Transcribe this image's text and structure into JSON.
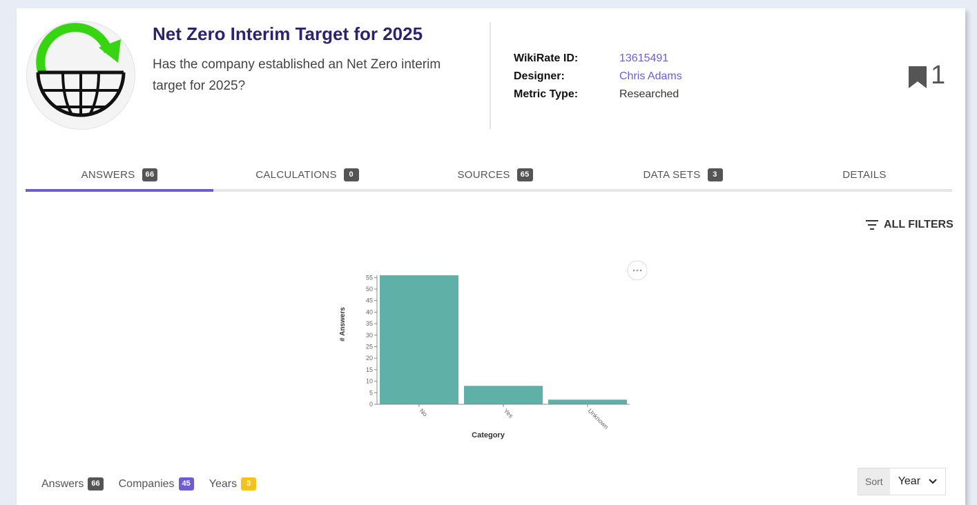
{
  "header": {
    "title": "Net Zero Interim Target for 2025",
    "question": "Has the company established an Net Zero interim target for 2025?",
    "wikirate_id_label": "WikiRate ID:",
    "wikirate_id": "13615491",
    "designer_label": "Designer:",
    "designer": "Chris Adams",
    "metric_type_label": "Metric Type:",
    "metric_type": "Researched",
    "bookmark_count": "1"
  },
  "tabs": [
    {
      "label": "ANSWERS",
      "badge": "66",
      "active": true
    },
    {
      "label": "CALCULATIONS",
      "badge": "0"
    },
    {
      "label": "SOURCES",
      "badge": "65"
    },
    {
      "label": "DATA SETS",
      "badge": "3"
    },
    {
      "label": "DETAILS"
    }
  ],
  "filters_label": "ALL FILTERS",
  "chart_data": {
    "type": "bar",
    "categories": [
      "No",
      "Yes",
      "Unknown"
    ],
    "values": [
      56,
      8,
      2
    ],
    "xlabel": "Category",
    "ylabel": "# Answers",
    "yticks": [
      0,
      5,
      10,
      15,
      20,
      25,
      30,
      35,
      40,
      45,
      50,
      55
    ],
    "ylim": [
      0,
      56
    ],
    "bar_color": "#5fb0a6",
    "grid": false
  },
  "bottom": {
    "answers_label": "Answers",
    "answers_count": "66",
    "companies_label": "Companies",
    "companies_count": "45",
    "years_label": "Years",
    "years_count": "3",
    "sort_label": "Sort",
    "sort_value": "Year"
  },
  "colors": {
    "accent": "#6c5dd3",
    "title": "#2d2270",
    "logo_green": "#37d411"
  },
  "icons": {
    "logo": "globe-arrow-icon",
    "bookmark": "bookmark-icon",
    "filter": "filter-icon",
    "menu": "more-icon",
    "sort": "chevron-down-icon"
  }
}
